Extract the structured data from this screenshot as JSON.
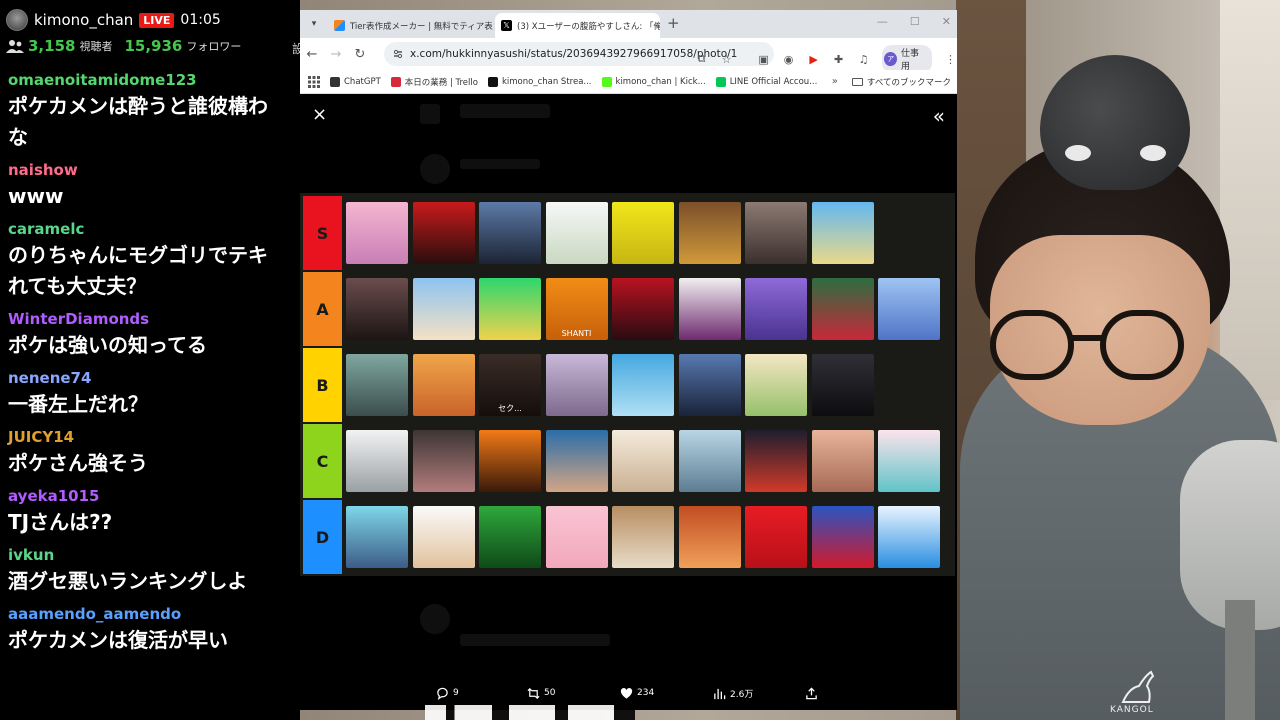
{
  "stream": {
    "channel": "kimono_chan",
    "live_label": "LIVE",
    "time": "01:05",
    "viewers": "3,158",
    "viewers_label": "視聴者",
    "followers": "15,936",
    "followers_label": "フォロワー",
    "cut_char": "設"
  },
  "chat": [
    {
      "user": "omaenoitamidome123",
      "color": "#55d66f",
      "lines": [
        "ポケカメンは酔うと誰彼構わ",
        "な"
      ]
    },
    {
      "user": "naishow",
      "color": "#ff6b8a",
      "lines": [
        "www"
      ]
    },
    {
      "user": "caramelc",
      "color": "#5ad68a",
      "lines": [
        "のりちゃんにモグゴリでテキ",
        "れても大丈夫？"
      ]
    },
    {
      "user": "WinterDiamonds",
      "color": "#b05cff",
      "lines": [
        "ポケは強いの知ってる"
      ]
    },
    {
      "user": "nenene74",
      "color": "#8aa6ff",
      "lines": [
        "一番左上だれ？"
      ]
    },
    {
      "user": "JUICY14",
      "color": "#e0a030",
      "lines": [
        "ポケさん強そう"
      ]
    },
    {
      "user": "ayeka1015",
      "color": "#b05cff",
      "lines": [
        "TJさんは??"
      ]
    },
    {
      "user": "ivkun",
      "color": "#5ad68a",
      "lines": [
        "酒グセ悪いランキングしよ"
      ]
    },
    {
      "user": "aaamendo_aamendo",
      "color": "#5aa0ff",
      "lines": [
        "ポケカメンは復活が早い"
      ]
    }
  ],
  "browser": {
    "tab1_title": "Tier表作成メーカー | 無料でティア表",
    "tab2_title": "(3) Xユーザーの腹筋やすしさん: 「俺",
    "url": "x.com/hukkinnyasushi/status/2036943927966917058/photo/1",
    "profile_label": "仕事用",
    "profile_initial": "ア",
    "bookmarks": [
      "ChatGPT",
      "本日の業務 | Trello",
      "kimono_chan Strea...",
      "kimono_chan | Kick...",
      "LINE Official Accou..."
    ],
    "bookmark_colors": [
      "#333333",
      "#d6283a",
      "#111111",
      "#53fc18",
      "#06c755"
    ],
    "all_bookmarks": "すべてのブックマーク"
  },
  "viewer": {
    "close": "×",
    "collapse": "«"
  },
  "tiers": [
    {
      "label": "S",
      "color": "#e8131f",
      "cells": [
        {
          "bg": "linear-gradient(180deg,#f4b6d0,#c87fb6)"
        },
        {
          "bg": "linear-gradient(180deg,#c81b1b,#2a0d0d)"
        },
        {
          "bg": "linear-gradient(180deg,#5d7aa8,#1c2433)"
        },
        {
          "bg": "linear-gradient(180deg,#f7f7f7,#c9d8c2)"
        },
        {
          "bg": "linear-gradient(180deg,#f0e61a,#c7b614)"
        },
        {
          "bg": "linear-gradient(180deg,#7b4f2a,#d09a3a)"
        },
        {
          "bg": "linear-gradient(180deg,#8c7a73,#3b302d)"
        },
        {
          "bg": "linear-gradient(180deg,#64b8f0,#e9d98a)"
        }
      ]
    },
    {
      "label": "A",
      "color": "#f3841e",
      "cells": [
        {
          "bg": "linear-gradient(180deg,#6b4d4d,#1d1414)"
        },
        {
          "bg": "linear-gradient(180deg,#8ec3f0,#f4e1c4)"
        },
        {
          "bg": "linear-gradient(180deg,#2ed66e,#f0d24c)"
        },
        {
          "bg": "linear-gradient(180deg,#f28c16,#c6600a)",
          "text": "SHANTI"
        },
        {
          "bg": "linear-gradient(180deg,#b7131f,#2a0b12)"
        },
        {
          "bg": "linear-gradient(180deg,#f0eff0,#6e2a6e)"
        },
        {
          "bg": "linear-gradient(180deg,#8e6ad8,#4a3390)"
        },
        {
          "bg": "linear-gradient(180deg,#2c6e40,#c8283a)"
        },
        {
          "bg": "linear-gradient(180deg,#9fc4f2,#4f74c7)"
        }
      ]
    },
    {
      "label": "B",
      "color": "#ffd200",
      "cells": [
        {
          "bg": "linear-gradient(180deg,#7fa7a0,#3b4e4c)"
        },
        {
          "bg": "linear-gradient(180deg,#f0a64a,#c9622a)"
        },
        {
          "bg": "linear-gradient(180deg,#3b2c26,#140e0c)",
          "text": "セク..."
        },
        {
          "bg": "linear-gradient(180deg,#c9b8d8,#7d6a8c)"
        },
        {
          "bg": "linear-gradient(180deg,#45a8e0,#b0e0f4)"
        },
        {
          "bg": "linear-gradient(180deg,#5879b0,#1a233a)"
        },
        {
          "bg": "linear-gradient(180deg,#f4e7c4,#96c06a)"
        },
        {
          "bg": "linear-gradient(180deg,#2f2f36,#0d0d10)"
        }
      ]
    },
    {
      "label": "C",
      "color": "#8fd41c",
      "cells": [
        {
          "bg": "linear-gradient(180deg,#f2f2f2,#9aa0a4)"
        },
        {
          "bg": "linear-gradient(180deg,#3d3535,#b37c7c)"
        },
        {
          "bg": "linear-gradient(180deg,#f27a16,#3a1a0a)"
        },
        {
          "bg": "linear-gradient(180deg,#2a6da8,#d3a586)"
        },
        {
          "bg": "linear-gradient(180deg,#f4eadc,#cbb192)"
        },
        {
          "bg": "linear-gradient(180deg,#b9d6e6,#5c7d92)"
        },
        {
          "bg": "linear-gradient(180deg,#1e1e2e,#d13a2a)"
        },
        {
          "bg": "linear-gradient(180deg,#e7b49a,#a66a56)"
        },
        {
          "bg": "linear-gradient(180deg,#fbe3ec,#60c4c8)"
        }
      ]
    },
    {
      "label": "D",
      "color": "#1e8fff",
      "cells": [
        {
          "bg": "linear-gradient(180deg,#7fd7e8,#3c5c88)"
        },
        {
          "bg": "linear-gradient(180deg,#fafafa,#e2c29c)"
        },
        {
          "bg": "linear-gradient(180deg,#2fa83c,#0f4a18)"
        },
        {
          "bg": "linear-gradient(180deg,#f9c4d4,#f2a8bc)"
        },
        {
          "bg": "linear-gradient(180deg,#b88e62,#e8dcc8)"
        },
        {
          "bg": "linear-gradient(180deg,#c24d22,#f0a05a)"
        },
        {
          "bg": "linear-gradient(180deg,#e81c24,#b81018)"
        },
        {
          "bg": "linear-gradient(180deg,#2a54c2,#d31a2a)"
        },
        {
          "bg": "linear-gradient(180deg,#e8f4ff,#2a8ee0)"
        }
      ]
    }
  ],
  "actions": {
    "replies": "9",
    "reposts": "50",
    "likes": "234",
    "views": "2.6万"
  },
  "kangol_label": "KANGOL"
}
